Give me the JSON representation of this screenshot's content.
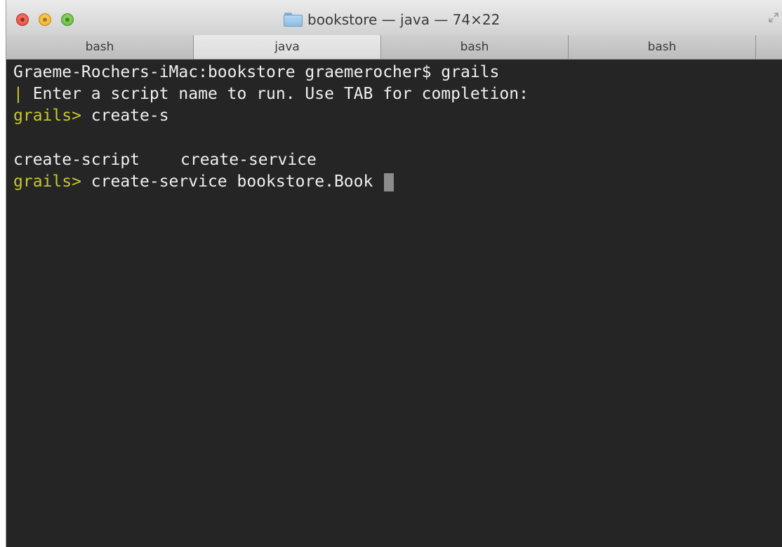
{
  "window": {
    "title": "bookstore — java — 74×22",
    "folder_icon": "folder-icon",
    "resize_icon": "fullscreen-icon"
  },
  "tabs": [
    {
      "label": "bash",
      "active": false
    },
    {
      "label": "java",
      "active": true
    },
    {
      "label": "bash",
      "active": false
    },
    {
      "label": "bash",
      "active": false
    }
  ],
  "terminal": {
    "line1": "Graeme-Rochers-iMac:bookstore graemerocher$ grails",
    "line2_marker": "|",
    "line2_text": " Enter a script name to run. Use TAB for completion:",
    "line3_prompt": "grails>",
    "line3_text": " create-s",
    "completion_1": "create-script",
    "completion_2": "create-service",
    "line5_prompt": "grails>",
    "line5_text": " create-service bookstore.Book "
  },
  "colors": {
    "background": "#252525",
    "text": "#efefef",
    "prompt": "#c6c82b"
  }
}
